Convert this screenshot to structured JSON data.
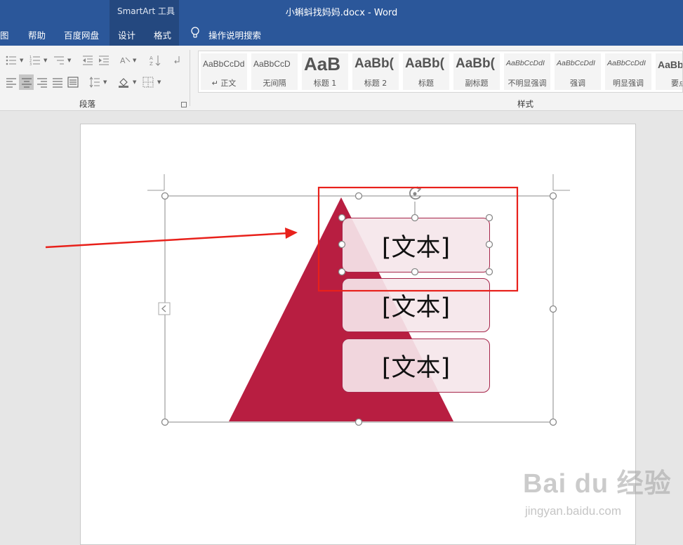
{
  "window": {
    "title": "小蝌蚪找妈妈.docx  -  Word",
    "context_tab_group": "SmartArt 工具"
  },
  "tabs": [
    "图",
    "帮助",
    "百度网盘",
    "设计",
    "格式"
  ],
  "tell_me": "操作说明搜索",
  "ribbon": {
    "paragraph_group": "段落",
    "styles_group": "样式",
    "styles": [
      {
        "sample": "AaBbCcDd",
        "name": "↵ 正文"
      },
      {
        "sample": "AaBbCcD",
        "name": "无间隔"
      },
      {
        "sample": "AaB",
        "name": "标题 1"
      },
      {
        "sample": "AaBb(",
        "name": "标题 2"
      },
      {
        "sample": "AaBb(",
        "name": "标题"
      },
      {
        "sample": "AaBb(",
        "name": "副标题"
      },
      {
        "sample": "AaBbCcDdI",
        "name": "不明显强调"
      },
      {
        "sample": "AaBbCcDdI",
        "name": "强调"
      },
      {
        "sample": "AaBbCcDdI",
        "name": "明显强调"
      },
      {
        "sample": "AaBb",
        "name": "要点"
      }
    ]
  },
  "smartart": {
    "items": [
      "[文本]",
      "[文本]",
      "[文本]"
    ],
    "colors": {
      "pyramid": "#b81e41",
      "box_fill": "#f5e6ea",
      "box_border": "#a6254a",
      "annotation": "#e8211b"
    }
  },
  "watermark": {
    "logo": "Bai du 经验",
    "url": "jingyan.baidu.com"
  }
}
